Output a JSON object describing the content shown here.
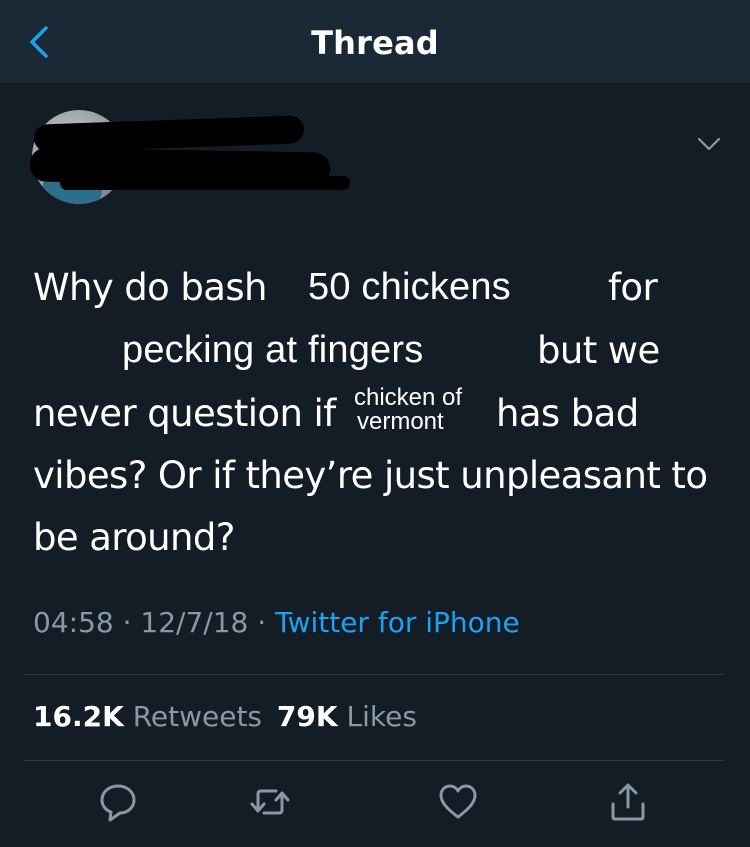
{
  "header": {
    "title": "Thread",
    "back_icon": "chevron-left-icon"
  },
  "tweet": {
    "menu_icon": "chevron-down-icon",
    "text_line1_a": "Why do bash",
    "insert_1": "50 chickens",
    "text_line1_b": "for",
    "insert_2": "pecking at fingers",
    "text_line2_b": "but we",
    "text_line3_a": "never question if",
    "insert_3_line1": "chicken of",
    "insert_3_line2": "vermont",
    "text_line3_b": "has bad",
    "text_line4": "vibes? Or if they’re just unpleasant to",
    "text_line5": "be around?",
    "time": "04:58",
    "date": "12/7/18",
    "sep": "·",
    "source": "Twitter for iPhone"
  },
  "stats": {
    "retweets_count": "16.2K",
    "retweets_label": "Retweets",
    "likes_count": "79K",
    "likes_label": "Likes"
  },
  "actions": {
    "reply_icon": "reply-icon",
    "retweet_icon": "retweet-icon",
    "like_icon": "heart-icon",
    "share_icon": "share-icon"
  },
  "colors": {
    "background": "#141d26",
    "header": "#1b2836",
    "accent": "#1da1f2",
    "muted": "#8899a6"
  }
}
